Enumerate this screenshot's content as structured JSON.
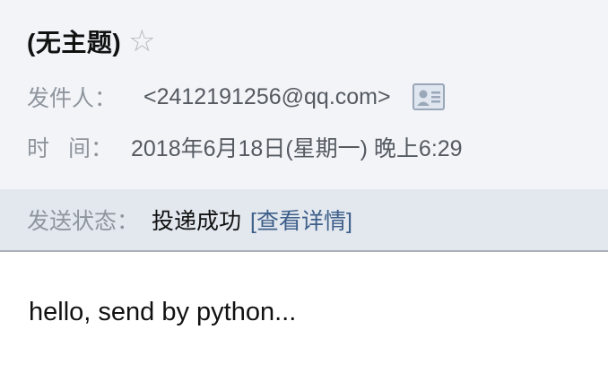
{
  "subject": "(无主题)",
  "star_icon": "star-outline-icon",
  "sender": {
    "label": "发件人：",
    "value": "<2412191256@qq.com>",
    "card_icon": "contact-card-icon"
  },
  "time": {
    "label_left": "时",
    "label_right": "间：",
    "value": "2018年6月18日(星期一) 晚上6:29"
  },
  "status": {
    "label": "发送状态：",
    "value": "投递成功",
    "link": "[查看详情]"
  },
  "body": {
    "text": "hello, send by python..."
  },
  "colors": {
    "header_bg": "#f2f4f8",
    "status_bg": "#e3e8ef",
    "link": "#3e5f8a",
    "label": "#8f959d"
  }
}
